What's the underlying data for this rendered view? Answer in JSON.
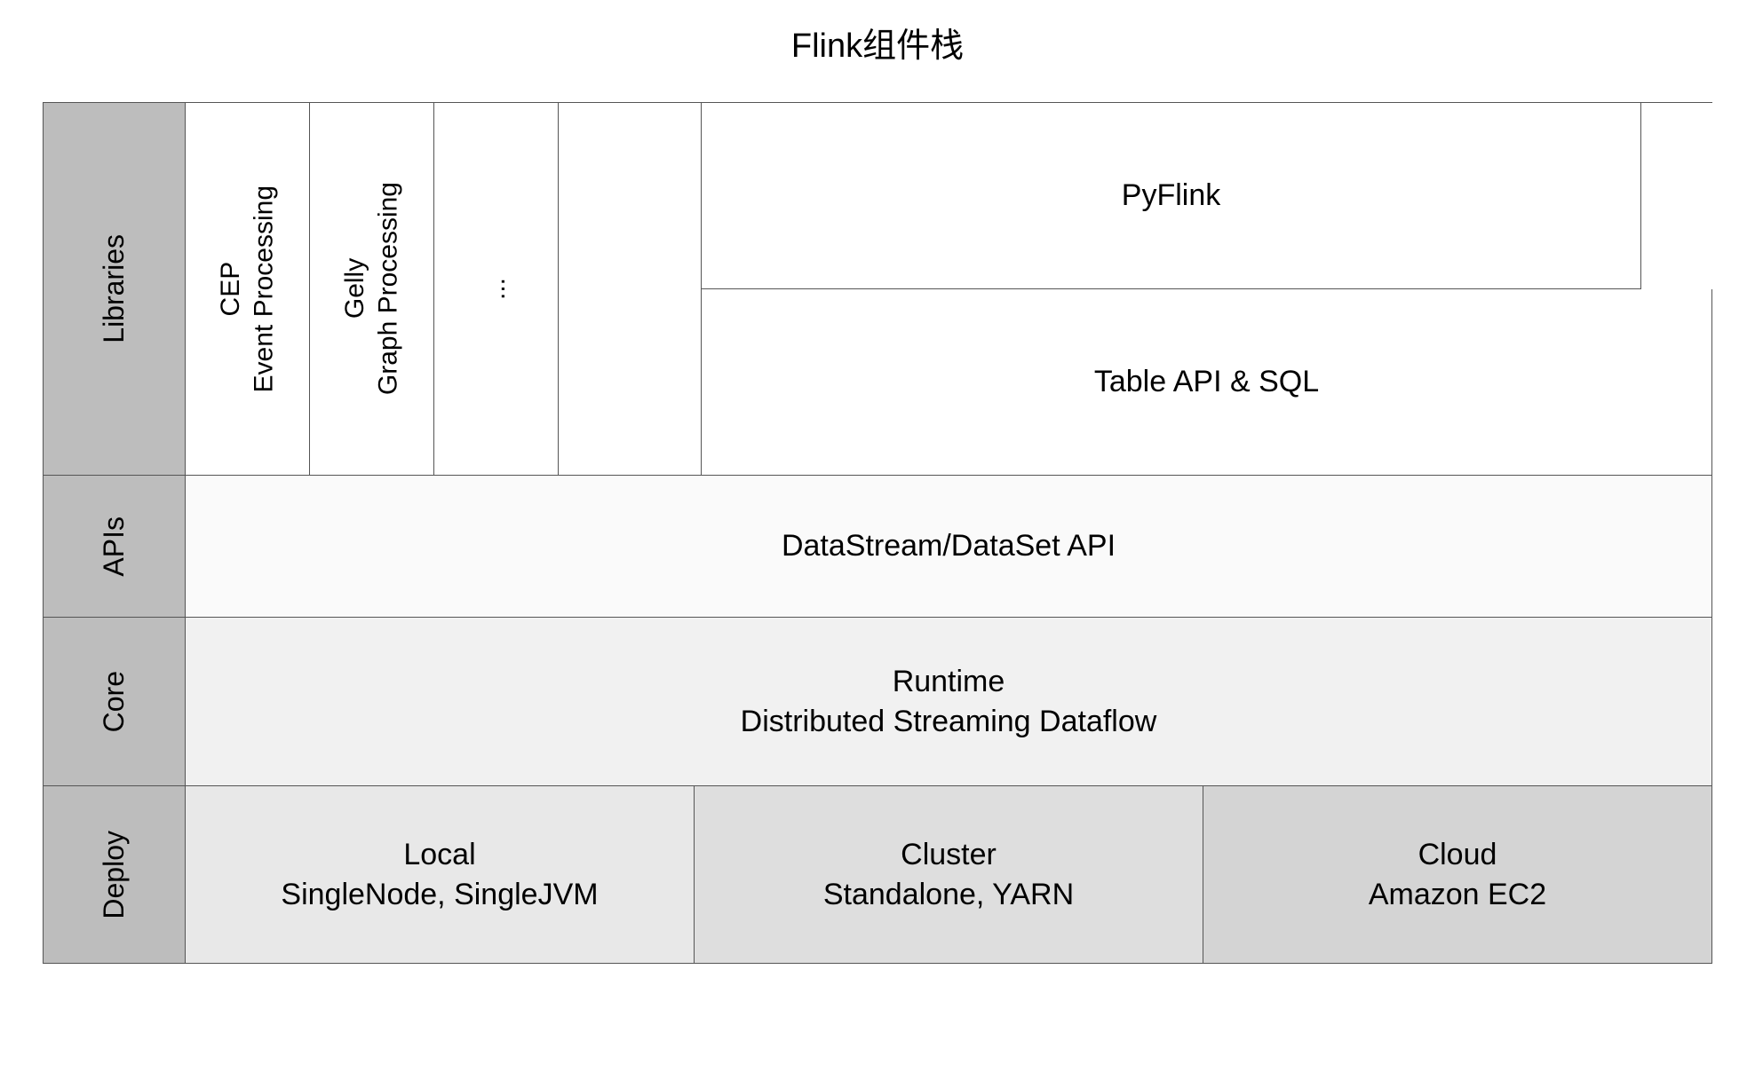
{
  "title": "Flink组件栈",
  "layers": {
    "libraries": {
      "label": "Libraries",
      "items": [
        {
          "title": "CEP",
          "subtitle": "Event Processing"
        },
        {
          "title": "Gelly",
          "subtitle": "Graph Processing"
        },
        {
          "title": "...",
          "subtitle": ""
        }
      ],
      "right": {
        "top": "PyFlink",
        "bottom": "Table API & SQL"
      }
    },
    "apis": {
      "label": "APIs",
      "content": "DataStream/DataSet API"
    },
    "core": {
      "label": "Core",
      "line1": "Runtime",
      "line2": "Distributed Streaming Dataflow"
    },
    "deploy": {
      "label": "Deploy",
      "cells": [
        {
          "title": "Local",
          "subtitle": "SingleNode, SingleJVM"
        },
        {
          "title": "Cluster",
          "subtitle": "Standalone, YARN"
        },
        {
          "title": "Cloud",
          "subtitle": "Amazon EC2"
        }
      ]
    }
  }
}
